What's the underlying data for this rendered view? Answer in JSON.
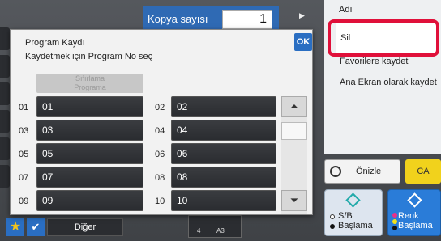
{
  "copies": {
    "label": "Kopya sayısı",
    "value": "1"
  },
  "right_panel": {
    "title": "Adı",
    "items": [
      {
        "label": "Sil",
        "highlighted": true
      },
      {
        "label": "Favorilere kaydet"
      },
      {
        "label": "Ana Ekran olarak kaydet"
      }
    ]
  },
  "actions": {
    "preview": "Önizle",
    "ca": "CA"
  },
  "start": {
    "bw": "S/B\nBaşlama",
    "color": "Renk\nBaşlama"
  },
  "bottom_bar": {
    "other": "Diğer",
    "tray_left": "4",
    "tray_right": "A3"
  },
  "dialog": {
    "title": "Program Kaydı",
    "subtitle": "Kaydetmek için Program No seç",
    "ok": "OK",
    "reset": "Sıfırlama\nPrograma",
    "slots": [
      {
        "no": "01",
        "label": "01"
      },
      {
        "no": "02",
        "label": "02"
      },
      {
        "no": "03",
        "label": "03"
      },
      {
        "no": "04",
        "label": "04"
      },
      {
        "no": "05",
        "label": "05"
      },
      {
        "no": "06",
        "label": "06"
      },
      {
        "no": "07",
        "label": "07"
      },
      {
        "no": "08",
        "label": "08"
      },
      {
        "no": "09",
        "label": "09"
      },
      {
        "no": "10",
        "label": "10"
      }
    ]
  },
  "colors": {
    "accent": "#2a6ec2",
    "highlight": "#e0103a",
    "ca": "#f1d21c"
  }
}
